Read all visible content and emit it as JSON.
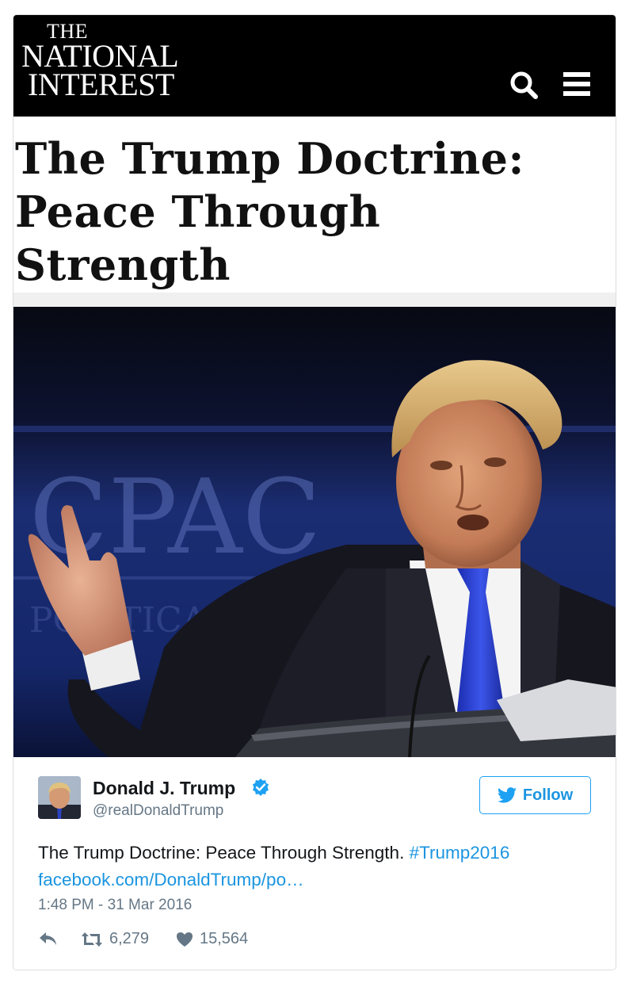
{
  "masthead": {
    "logo_line1": "THE",
    "logo_line2": "NATIONAL",
    "logo_line3": "INTEREST",
    "search_icon": "search-icon",
    "menu_icon": "hamburger-menu-icon"
  },
  "article": {
    "headline": "The Trump Doctrine: Peace Through Strength"
  },
  "photo": {
    "backdrop_text_large": "CPAC",
    "backdrop_text_small": "POLITICAL"
  },
  "tweet": {
    "author_name": "Donald J. Trump",
    "verified_icon": "verified-badge-icon",
    "handle": "@realDonaldTrump",
    "follow_label": "Follow",
    "text": "The Trump Doctrine: Peace Through Strength.",
    "hashtag": "#Trump2016",
    "link": "facebook.com/DonaldTrump/po…",
    "timestamp": "1:48 PM - 31 Mar 2016",
    "retweet_count": "6,279",
    "like_count": "15,564"
  },
  "colors": {
    "link_blue": "#1b95e0",
    "follow_border": "#1da1f2",
    "muted_gray": "#657786",
    "masthead_bg": "#000000"
  }
}
